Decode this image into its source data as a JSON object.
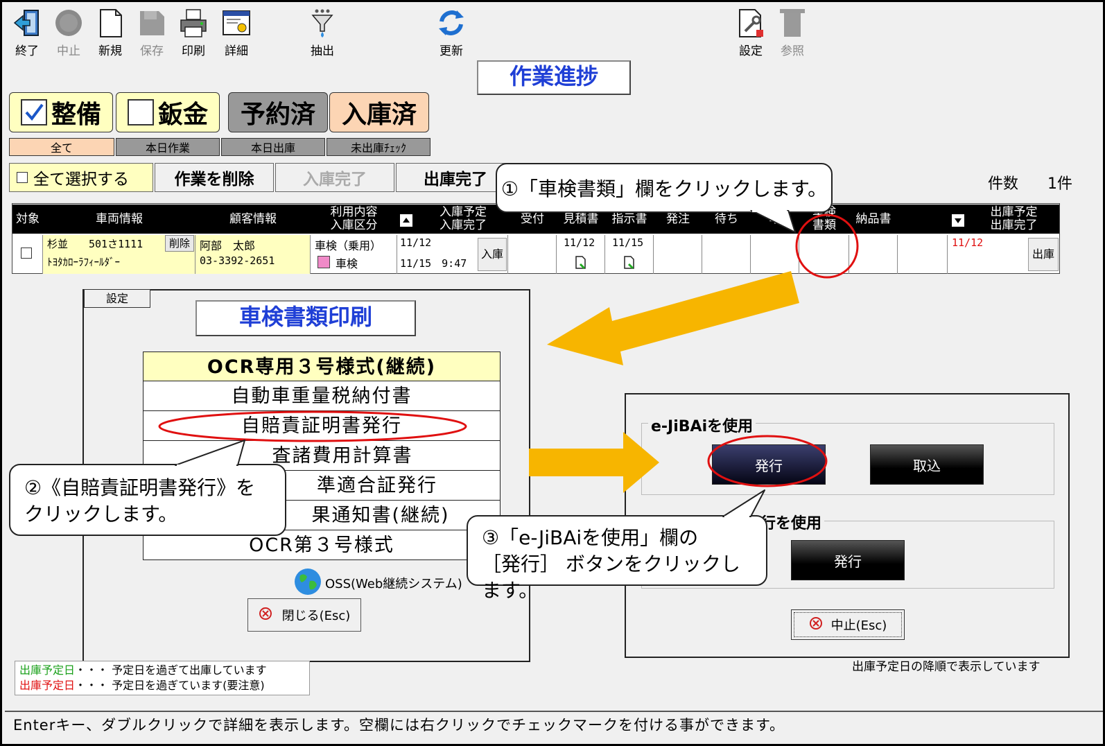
{
  "toolbar": {
    "items": [
      {
        "label": "終了",
        "icon": "exit-door-icon",
        "enabled": true
      },
      {
        "label": "中止",
        "icon": "stop-circle-icon",
        "enabled": false
      },
      {
        "label": "新規",
        "icon": "new-document-icon",
        "enabled": true
      },
      {
        "label": "保存",
        "icon": "save-icon",
        "enabled": false
      },
      {
        "label": "印刷",
        "icon": "printer-icon",
        "enabled": true
      },
      {
        "label": "詳細",
        "icon": "detail-window-icon",
        "enabled": true
      },
      {
        "label": "抽出",
        "icon": "funnel-filter-icon",
        "enabled": true
      },
      {
        "label": "更新",
        "icon": "refresh-icon",
        "enabled": true
      },
      {
        "label": "設定",
        "icon": "settings-document-icon",
        "enabled": true
      },
      {
        "label": "参照",
        "icon": "browse-icon",
        "enabled": false
      }
    ]
  },
  "page_title": "作業進捗",
  "filters": {
    "seibi": {
      "label": "整備",
      "checked": true
    },
    "bankin": {
      "label": "鈑金",
      "checked": false
    },
    "yoyaku": "予約済",
    "nyuko": "入庫済"
  },
  "tabs": [
    "全て",
    "本日作業",
    "本日出庫",
    "未出庫ﾁｪｯｸ"
  ],
  "actions": {
    "select_all": "全て選択する",
    "delete": "作業を削除",
    "nyuko_done": "入庫完了",
    "shukko_done": "出庫完了"
  },
  "count": {
    "label": "件数",
    "value": "1件"
  },
  "grid": {
    "headers": {
      "taisho": "対象",
      "sharyo": "車両情報",
      "kokyaku": "顧客情報",
      "riyo": [
        "利用内容",
        "入庫区分"
      ],
      "nyuko": [
        "入庫予定",
        "入庫完了"
      ],
      "uketsuke": "受付",
      "mitsumori": "見積書",
      "shiji": "指示書",
      "hatchu": "発注",
      "machi": "待ち",
      "kijun": "準",
      "shaken": [
        "車検",
        "書類"
      ],
      "nohin": "納品書",
      "shukko": [
        "出庫予定",
        "出庫完了"
      ]
    },
    "row": {
      "plate": "杉並　　501さ1111",
      "delete_label": "削除",
      "car": "ﾄﾖﾀｶﾛｰﾗﾌｨｰﾙﾀﾞｰ",
      "customer": "阿部　太郎",
      "phone": "03-3392-2651",
      "usage": "車検（乗用）",
      "category": "車検",
      "nyuko_plan": "11/12",
      "nyuko_done": "11/15　9:47",
      "nyuko_btn": "入庫",
      "mitsumori": "11/12",
      "shiji": "11/15",
      "shukko_plan": "11/12",
      "shukko_btn": "出庫"
    }
  },
  "print_dialog": {
    "tab": "設定",
    "title": "車検書類印刷",
    "items": [
      "OCR専用３号様式(継続)",
      "自動車重量税納付書",
      "自賠責証明書発行",
      "査諸費用計算書",
      "準適合証発行",
      "果通知書(継続)",
      "OCR第３号様式"
    ],
    "oss": "OSS(Web継続システム)",
    "close": "閉じる(Esc)"
  },
  "jibai_dialog": {
    "group1": "e-JiBAiを使用",
    "issue": "発行",
    "import": "取込",
    "group2": "発行を使用",
    "issue2": "発行",
    "cancel": "中止(Esc)"
  },
  "legend": {
    "item1_key": "出庫予定日",
    "item1_text": "・・・ 予定日を過ぎて出庫しています",
    "item2_key": "出庫予定日",
    "item2_text": "・・・ 予定日を過ぎています(要注意)"
  },
  "sort_note": "出庫予定日の降順で表示しています",
  "status_bar": "Enterキー、ダブルクリックで詳細を表示します。空欄には右クリックでチェックマークを付ける事ができます。",
  "callouts": {
    "c1": "①「車検書類」欄をクリックします。",
    "c2_l1": "②《自賠責証明書発行》を",
    "c2_l2": "クリックします。",
    "c3_l1": "③「e-JiBAiを使用」欄の",
    "c3_l2": "［発行］ ボタンをクリックします。"
  },
  "colors": {
    "accent_blue": "#1f3fd6",
    "orange_arrow": "#f7b500",
    "red_circle": "#e01010",
    "peach": "#fcd5b4",
    "yellow": "#ffffc0"
  }
}
